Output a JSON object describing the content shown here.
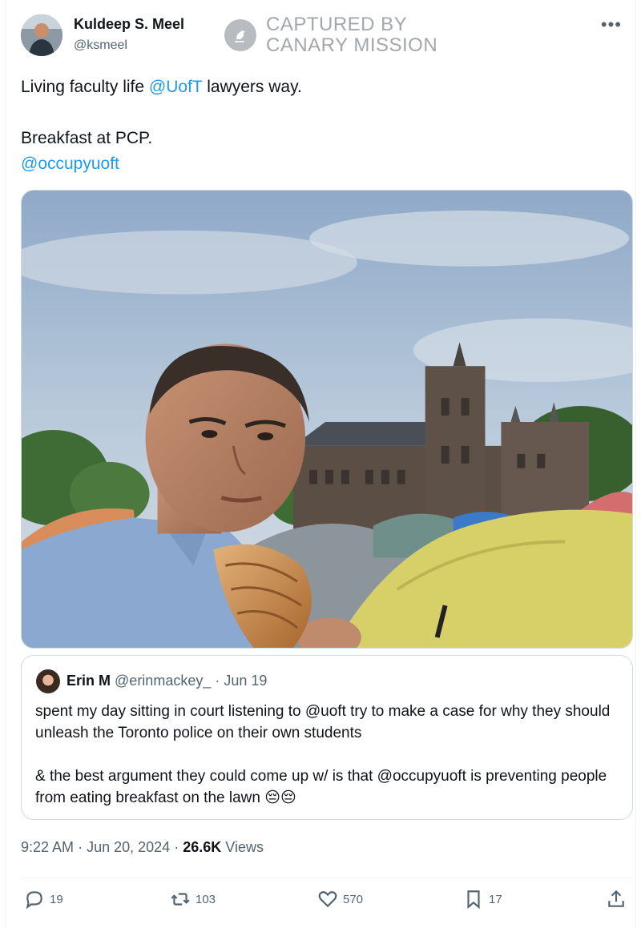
{
  "author": {
    "name": "Kuldeep S. Meel",
    "handle": "@ksmeel"
  },
  "watermark": {
    "line1": "CAPTURED BY",
    "line2": "CANARY MISSION"
  },
  "tweet": {
    "line1_prefix": "Living faculty life ",
    "line1_mention": "@UofT",
    "line1_suffix": " lawyers way.",
    "line2": "Breakfast at PCP.",
    "line3_mention": "@occupyuoft"
  },
  "quote": {
    "name": "Erin M",
    "handle": "@erinmackey_",
    "separator": "·",
    "date": "Jun 19",
    "paragraph1": "spent my day sitting in court listening to @uoft try to make a case for why they should unleash the Toronto police on their own students",
    "paragraph2": "& the best argument they could come up w/ is that @occupyuoft is preventing people from eating breakfast on the lawn 😔😔"
  },
  "meta": {
    "time": "9:22 AM",
    "separator": "·",
    "date": "Jun 20, 2024",
    "views_count": "26.6K",
    "views_label": "Views"
  },
  "actions": {
    "replies": "19",
    "reposts": "103",
    "likes": "570",
    "bookmarks": "17"
  },
  "colors": {
    "accent": "#1d9bf0",
    "secondary_text": "#536471",
    "border": "#cfd9de"
  }
}
